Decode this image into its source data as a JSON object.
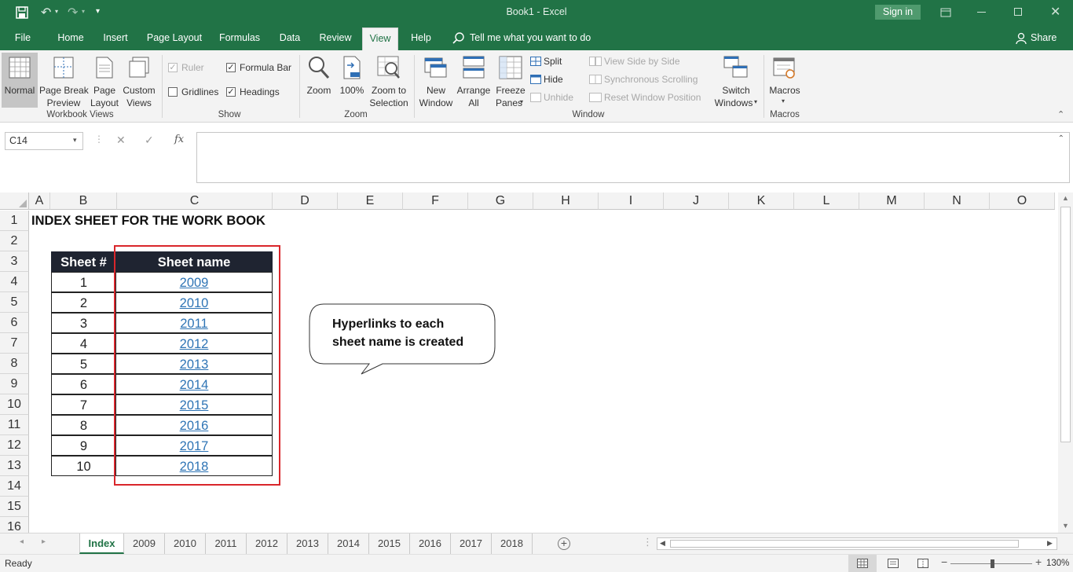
{
  "title": {
    "text": "Book1  -  Excel",
    "sign_in": "Sign in"
  },
  "tabs": [
    "File",
    "Home",
    "Insert",
    "Page Layout",
    "Formulas",
    "Data",
    "Review",
    "View",
    "Help"
  ],
  "tell_me": "Tell me what you want to do",
  "share": "Share",
  "ribbon": {
    "normal": "Normal",
    "page_break_1": "Page Break",
    "page_break_2": "Preview",
    "page_layout_1": "Page",
    "page_layout_2": "Layout",
    "custom_1": "Custom",
    "custom_2": "Views",
    "workbook_views": "Workbook Views",
    "ruler": "Ruler",
    "formula_bar": "Formula Bar",
    "gridlines": "Gridlines",
    "headings": "Headings",
    "show": "Show",
    "zoom": "Zoom",
    "hundred": "100%",
    "zoom_sel_1": "Zoom to",
    "zoom_sel_2": "Selection",
    "zoom_group": "Zoom",
    "new_window_1": "New",
    "new_window_2": "Window",
    "arrange_1": "Arrange",
    "arrange_2": "All",
    "freeze_1": "Freeze",
    "freeze_2": "Panes",
    "split": "Split",
    "hide": "Hide",
    "unhide": "Unhide",
    "view_side": "View Side by Side",
    "sync_scroll": "Synchronous Scrolling",
    "reset_pos": "Reset Window Position",
    "switch_1": "Switch",
    "switch_2": "Windows",
    "window_group": "Window",
    "macros": "Macros",
    "macros_group": "Macros"
  },
  "name_box": "C14",
  "fx": "fx",
  "columns": [
    "A",
    "B",
    "C",
    "D",
    "E",
    "F",
    "G",
    "H",
    "I",
    "J",
    "K",
    "L",
    "M",
    "N",
    "O"
  ],
  "rows": [
    "1",
    "2",
    "3",
    "4",
    "5",
    "6",
    "7",
    "8",
    "9",
    "10",
    "11",
    "12",
    "13",
    "14",
    "15",
    "16"
  ],
  "sheet_title": "INDEX SHEET FOR THE WORK BOOK",
  "table": {
    "headers": [
      "Sheet #",
      "Sheet name"
    ],
    "rows": [
      [
        "1",
        "2009"
      ],
      [
        "2",
        "2010"
      ],
      [
        "3",
        "2011"
      ],
      [
        "4",
        "2012"
      ],
      [
        "5",
        "2013"
      ],
      [
        "6",
        "2014"
      ],
      [
        "7",
        "2015"
      ],
      [
        "8",
        "2016"
      ],
      [
        "9",
        "2017"
      ],
      [
        "10",
        "2018"
      ]
    ]
  },
  "callout": {
    "line1": "Hyperlinks to each",
    "line2": "sheet name is created"
  },
  "sheet_tabs": [
    "Index",
    "2009",
    "2010",
    "2011",
    "2012",
    "2013",
    "2014",
    "2015",
    "2016",
    "2017",
    "2018"
  ],
  "status": {
    "ready": "Ready",
    "zoom": "130%"
  },
  "colors": {
    "excel_green": "#217346",
    "link": "#2e74b5",
    "table_header": "#1f2431",
    "highlight_border": "#d9262b"
  }
}
